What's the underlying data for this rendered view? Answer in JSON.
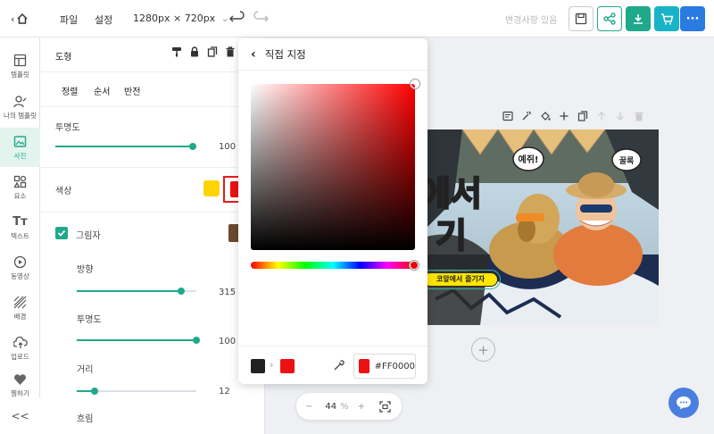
{
  "topbar": {
    "menu_file": "파일",
    "menu_settings": "설정",
    "canvas_size": "1280px × 720px",
    "status": "변경사항 있음",
    "colors": {
      "green": "#1fa98a",
      "blue": "#2a7ae2",
      "teal": "#18b3c6"
    }
  },
  "sidebar": {
    "items": [
      {
        "label": "템플릿",
        "icon": "layout-icon"
      },
      {
        "label": "나의 템플릿",
        "icon": "user-edit-icon"
      },
      {
        "label": "사진",
        "icon": "image-icon"
      },
      {
        "label": "요소",
        "icon": "shapes-icon"
      },
      {
        "label": "텍스트",
        "icon": "text-icon"
      },
      {
        "label": "동영상",
        "icon": "play-icon"
      },
      {
        "label": "배경",
        "icon": "pattern-icon"
      },
      {
        "label": "업로드",
        "icon": "upload-icon"
      },
      {
        "label": "찜하기",
        "icon": "heart-icon"
      }
    ],
    "collapse": "<<"
  },
  "panel": {
    "title": "도형",
    "tabs": [
      "정렬",
      "순서",
      "반전"
    ],
    "opacity_label": "투명도",
    "opacity_value": "100",
    "color_label": "색상",
    "fill_colors": {
      "primary": "#ffd400",
      "selected": "#ee1111"
    },
    "shadow_label": "그림자",
    "shadow_checked": true,
    "shadow_color": "#6b4a2e",
    "direction_label": "방향",
    "direction_value": "315",
    "shadow_opacity_label": "투명도",
    "shadow_opacity_value": "100",
    "distance_label": "거리",
    "distance_value": "12",
    "blur_label": "흐림",
    "levels": {
      "opacity": 1.0,
      "direction": 0.87,
      "shadow_opacity": 1.0,
      "distance": 0.15
    }
  },
  "picker": {
    "title": "직접 지정",
    "from_color": "#222222",
    "to_color": "#ee1111",
    "hex_value": "#FF0000",
    "hue_color": "#ff0000"
  },
  "canvas": {
    "bubble1": "예쥐!",
    "bubble2": "꿀록",
    "headline1": "에서",
    "headline2": "기",
    "banner": "코앞에서 즐기자"
  },
  "zoom": {
    "minus": "−",
    "value": "44",
    "unit": "%",
    "plus": "+"
  }
}
